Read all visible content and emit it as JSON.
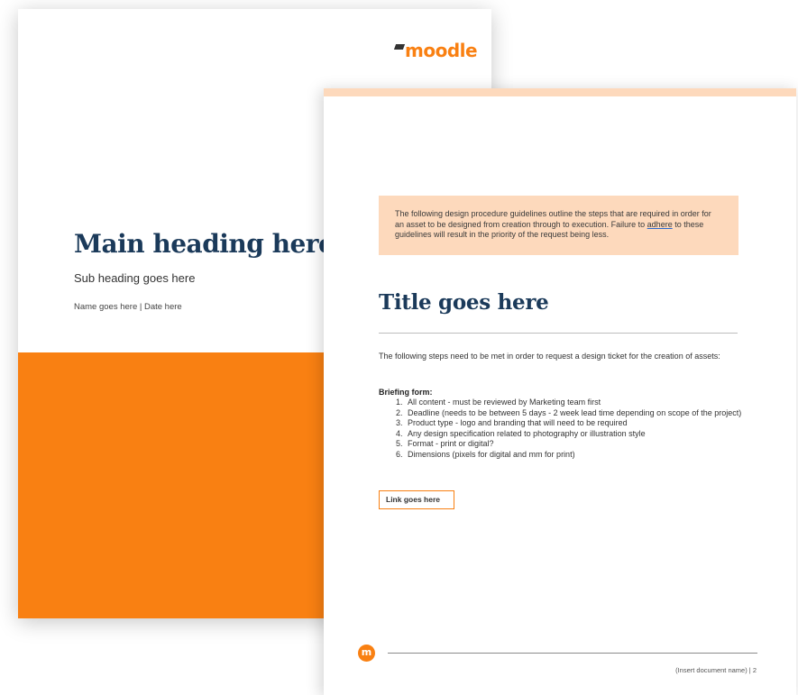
{
  "cover": {
    "logo_text": "moodle",
    "main_heading": "Main heading here",
    "sub_heading": "Sub heading goes here",
    "meta": "Name goes here | Date here"
  },
  "page": {
    "callout_before": "The following design procedure guidelines outline the steps that are required in order for an asset to be designed from creation through to execution. Failure to ",
    "callout_link_word": "adhere",
    "callout_after": " to these guidelines will result in the priority of the request being less.",
    "title": "Title goes here",
    "intro": "The following steps need to be met in order to request a design ticket for the creation of assets:",
    "briefing_label": "Briefing form:",
    "steps": [
      {
        "num": "1.",
        "text": "All content - must be reviewed by Marketing team first"
      },
      {
        "num": "2.",
        "text": "Deadline (needs to be between 5 days - 2 week lead time depending on scope of the project)"
      },
      {
        "num": "3.",
        "text": "Product type - logo and branding that will need to be required"
      },
      {
        "num": "4.",
        "text": "Any design specification related to photography or illustration style"
      },
      {
        "num": "5.",
        "text": "Format - print or digital?"
      },
      {
        "num": "6.",
        "text": "Dimensions (pixels for digital and mm for print)"
      }
    ],
    "link_label": "Link goes here",
    "footer_logo": "m",
    "footer_text": "(Insert document name) | 2"
  },
  "colors": {
    "brand_orange": "#f98012",
    "peach": "#fdd9bc",
    "navy": "#1b3a5a"
  },
  "icons": {
    "cover_logo": "moodle-logo-icon",
    "footer_logo": "moodle-m-logo-icon"
  }
}
